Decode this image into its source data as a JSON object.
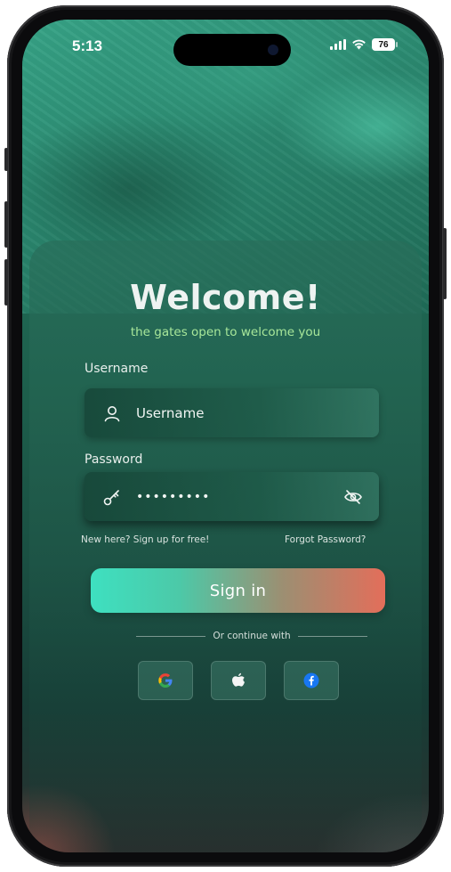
{
  "status_bar": {
    "time": "5:13",
    "battery": "76",
    "signal_icon": "signal-bars-icon",
    "wifi_icon": "wifi-icon"
  },
  "header": {
    "title": "Welcome!",
    "subtitle": "the gates open to welcome you"
  },
  "form": {
    "username_label": "Username",
    "username_value": "Username",
    "username_icon": "user-icon",
    "password_label": "Password",
    "password_value": "•••••••••",
    "password_icon": "key-icon",
    "visibility_icon": "eye-off-icon",
    "signup_link": "New here? Sign up for free!",
    "forgot_link": "Forgot Password?",
    "signin_label": "Sign in"
  },
  "social": {
    "divider_text": "Or continue with",
    "providers": [
      "google-icon",
      "apple-icon",
      "facebook-icon"
    ]
  },
  "colors": {
    "accent_start": "#3ee0c0",
    "accent_end": "#e36e5a",
    "subtitle": "#a8e79a",
    "background": "#1f6b56"
  }
}
